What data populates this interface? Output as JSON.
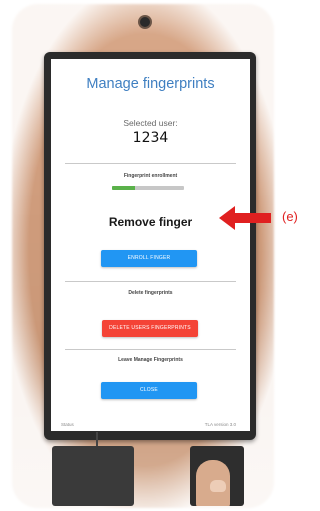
{
  "screen": {
    "title": "Manage fingerprints",
    "selected_user_label": "Selected user:",
    "selected_user_value": "1234",
    "enrollment_heading": "Fingerprint enrollment",
    "enrollment_progress": 0.32,
    "status_message": "Remove finger",
    "enroll_button": "ENROLL FINGER",
    "delete_heading": "Delete fingerprints",
    "delete_button": "DELETE USERS FINGERPRINTS",
    "leave_heading": "Leave Manage Fingerprints",
    "close_button": "CLOSE",
    "footer_status": "Status",
    "footer_version": "TLA version 3.0"
  },
  "annotation": {
    "label": "(e)",
    "color": "#e02020"
  },
  "colors": {
    "title": "#3f7fc1",
    "primary_button": "#2196f3",
    "danger_button": "#f44336",
    "progress": "#5ab14a"
  }
}
